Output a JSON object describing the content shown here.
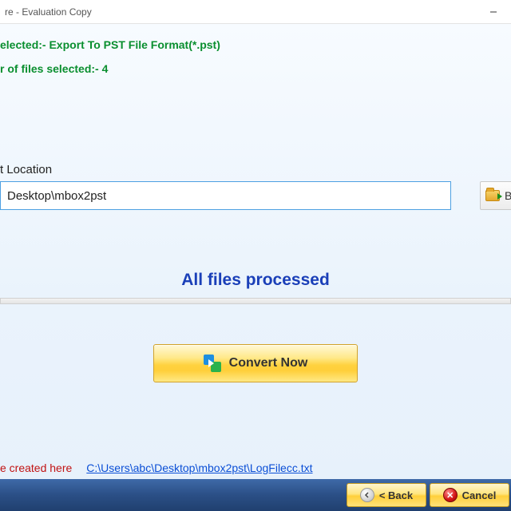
{
  "window": {
    "title": "re - Evaluation Copy"
  },
  "info": {
    "format_line": "elected:- Export To PST File Format(*.pst)",
    "count_line": "r of files selected:- 4"
  },
  "output": {
    "label": "t Location",
    "path": "Desktop\\mbox2pst",
    "browse_label": "B"
  },
  "progress": {
    "status": "All files processed"
  },
  "convert": {
    "label": "Convert Now"
  },
  "log": {
    "label": "e created here",
    "link": "C:\\Users\\abc\\Desktop\\mbox2pst\\LogFilecc.txt"
  },
  "nav": {
    "back": "< Back",
    "cancel": "Cancel"
  }
}
